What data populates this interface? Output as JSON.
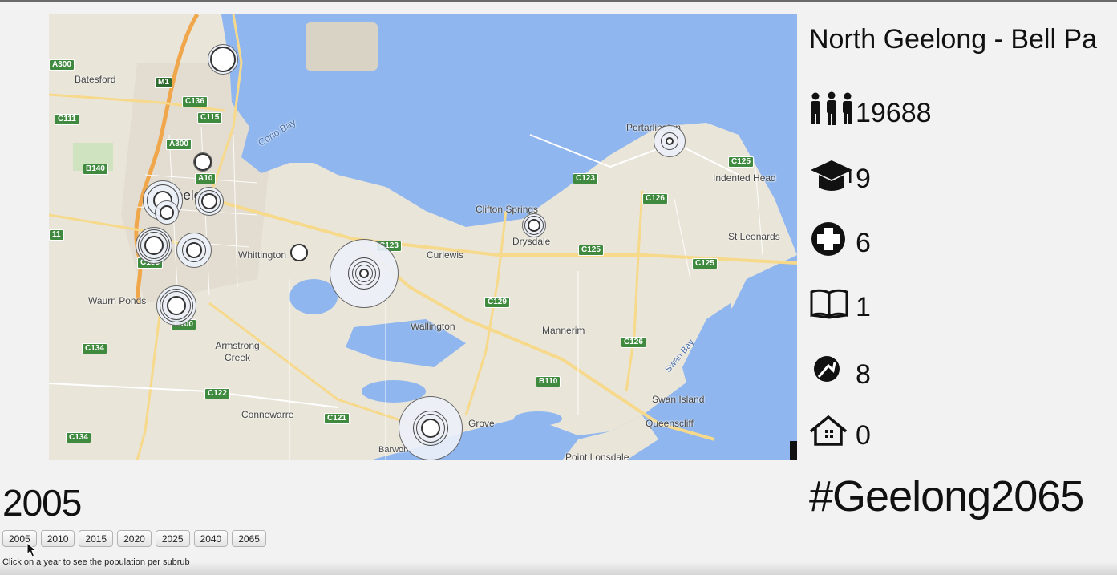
{
  "map": {
    "water_labels": [
      "Corio Bay",
      "Swan Bay"
    ],
    "places": [
      "Batesford",
      "Whittington",
      "Curlewis",
      "Clifton Springs",
      "Drysdale",
      "Portarlington",
      "Indented Head",
      "St Leonards",
      "Waurn Ponds",
      "Armstrong Creek",
      "Wallington",
      "Mannerim",
      "Swan Island",
      "Queenscliff",
      "Connewarre",
      "Grove",
      "Barwon",
      "Point Lonsdale",
      "eelong"
    ],
    "roads": [
      "A300",
      "M1",
      "C136",
      "C115",
      "C111",
      "A300",
      "B140",
      "A10",
      "C133",
      "C100",
      "C134",
      "C122",
      "C121",
      "C134",
      "C123",
      "C126",
      "C125",
      "C125",
      "C125",
      "C129",
      "C126",
      "B110",
      "C123",
      "11"
    ],
    "colors": {
      "land": "#e8e4d8",
      "water": "#8fb6ee",
      "freeway": "#f0a64b",
      "road": "#f7d98b"
    }
  },
  "panel": {
    "suburb_name": "North Geelong - Bell Pa",
    "stats": [
      {
        "icon": "population-icon",
        "value": "19688"
      },
      {
        "icon": "graduation-cap-icon",
        "value": "9"
      },
      {
        "icon": "medical-cross-icon",
        "value": "6"
      },
      {
        "icon": "book-icon",
        "value": "1"
      },
      {
        "icon": "sport-icon",
        "value": "8"
      },
      {
        "icon": "house-icon",
        "value": "0"
      }
    ],
    "hashtag": "#Geelong2065"
  },
  "years": {
    "current": "2005",
    "buttons": [
      "2005",
      "2010",
      "2015",
      "2020",
      "2025",
      "2040",
      "2065"
    ],
    "hint": "Click on a year to see the population per subrub"
  }
}
